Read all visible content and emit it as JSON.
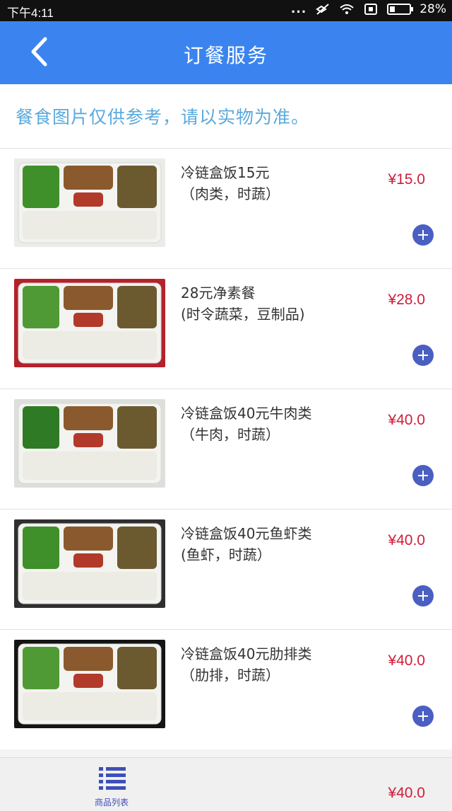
{
  "status_bar": {
    "time": "下午4:11",
    "dots": "...",
    "battery": "28%",
    "battery_level": 0.28
  },
  "header": {
    "title": "订餐服务",
    "back_icon": "chevron-left-icon"
  },
  "notice": "餐食图片仅供参考，请以实物为准。",
  "items": [
    {
      "name": "冷链盒饭15元",
      "desc": "（肉类，时蔬）",
      "price": "¥15.0",
      "frame": "#e9ece9"
    },
    {
      "name": "28元净素餐",
      "desc": "(时令蔬菜，豆制品)",
      "price": "¥28.0",
      "frame": "#b4212a"
    },
    {
      "name": "冷链盒饭40元牛肉类",
      "desc": "（牛肉，时蔬）",
      "price": "¥40.0",
      "frame": "#dcdfdc"
    },
    {
      "name": "冷链盒饭40元鱼虾类",
      "desc": "(鱼虾，时蔬）",
      "price": "¥40.0",
      "frame": "#2f2f2f"
    },
    {
      "name": "冷链盒饭40元肋排类",
      "desc": "（肋排，时蔬）",
      "price": "¥40.0",
      "frame": "#141414"
    }
  ],
  "bottom_bar": {
    "tab_label": "商品列表",
    "tab_icon": "list-icon",
    "price": "¥40.0"
  },
  "colors": {
    "header": "#3b84f0",
    "notice": "#5aa9de",
    "price": "#cf1d3b",
    "add_button": "#4a5fc1"
  }
}
